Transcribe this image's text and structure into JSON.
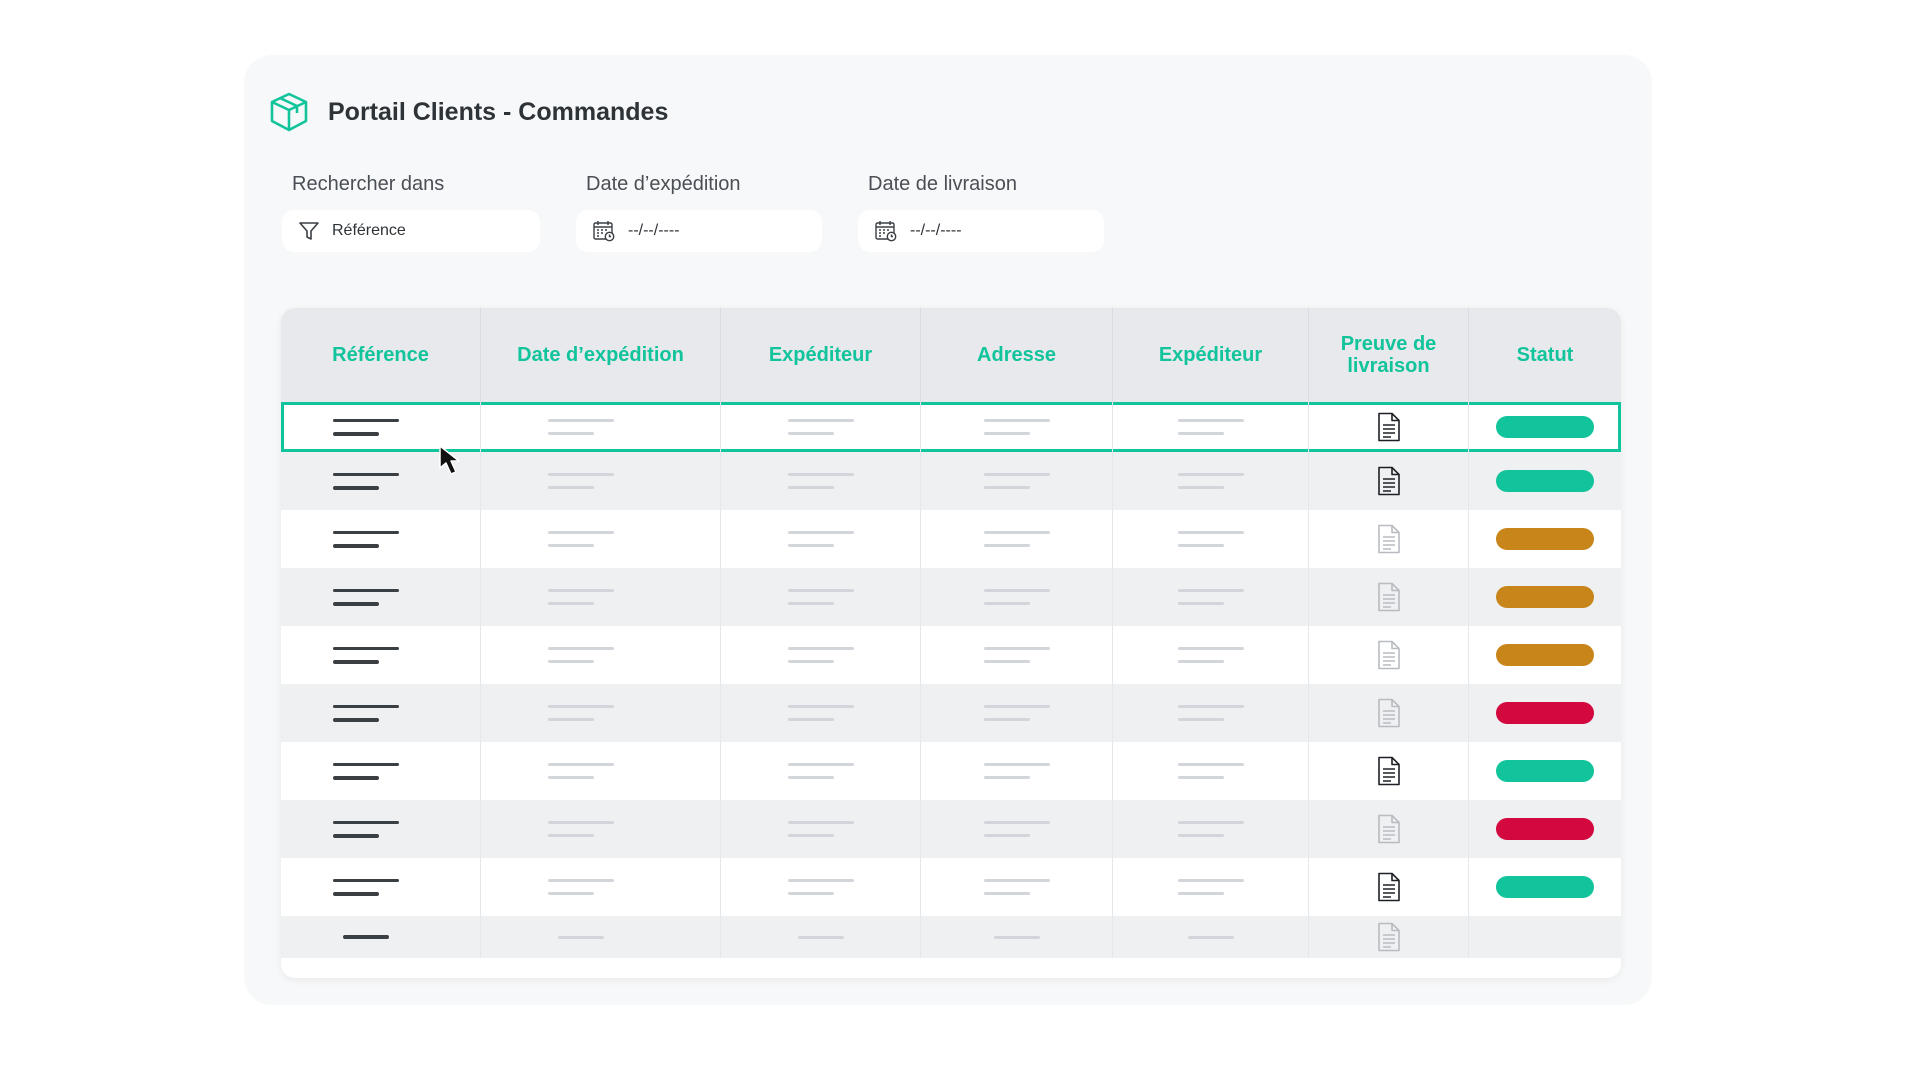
{
  "header": {
    "title": "Portail Clients - Commandes",
    "icon": "package-box-icon",
    "accent_color": "#12c49b"
  },
  "filters": {
    "search": {
      "label": "Rechercher dans",
      "value": "Référence",
      "icon": "filter-icon"
    },
    "ship_date": {
      "label": "Date d’expédition",
      "value": "--/--/----",
      "icon": "calendar-icon"
    },
    "delivery_date": {
      "label": "Date de livraison",
      "value": "--/--/----",
      "icon": "calendar-icon"
    }
  },
  "table": {
    "columns": [
      "Référence",
      "Date d’expédition",
      "Expéditeur",
      "Adresse",
      "Expéditeur",
      "Preuve de livraison",
      "Statut"
    ],
    "status_colors": {
      "green": "#12c49b",
      "orange": "#c8861a",
      "red": "#d3083f"
    },
    "rows": [
      {
        "proof": "available",
        "status": "green",
        "selected": true
      },
      {
        "proof": "available",
        "status": "green"
      },
      {
        "proof": "unavailable",
        "status": "orange"
      },
      {
        "proof": "unavailable",
        "status": "orange"
      },
      {
        "proof": "unavailable",
        "status": "orange"
      },
      {
        "proof": "unavailable",
        "status": "red"
      },
      {
        "proof": "available",
        "status": "green"
      },
      {
        "proof": "unavailable",
        "status": "red"
      },
      {
        "proof": "available",
        "status": "green"
      },
      {
        "proof": "unavailable",
        "status": ""
      }
    ]
  }
}
